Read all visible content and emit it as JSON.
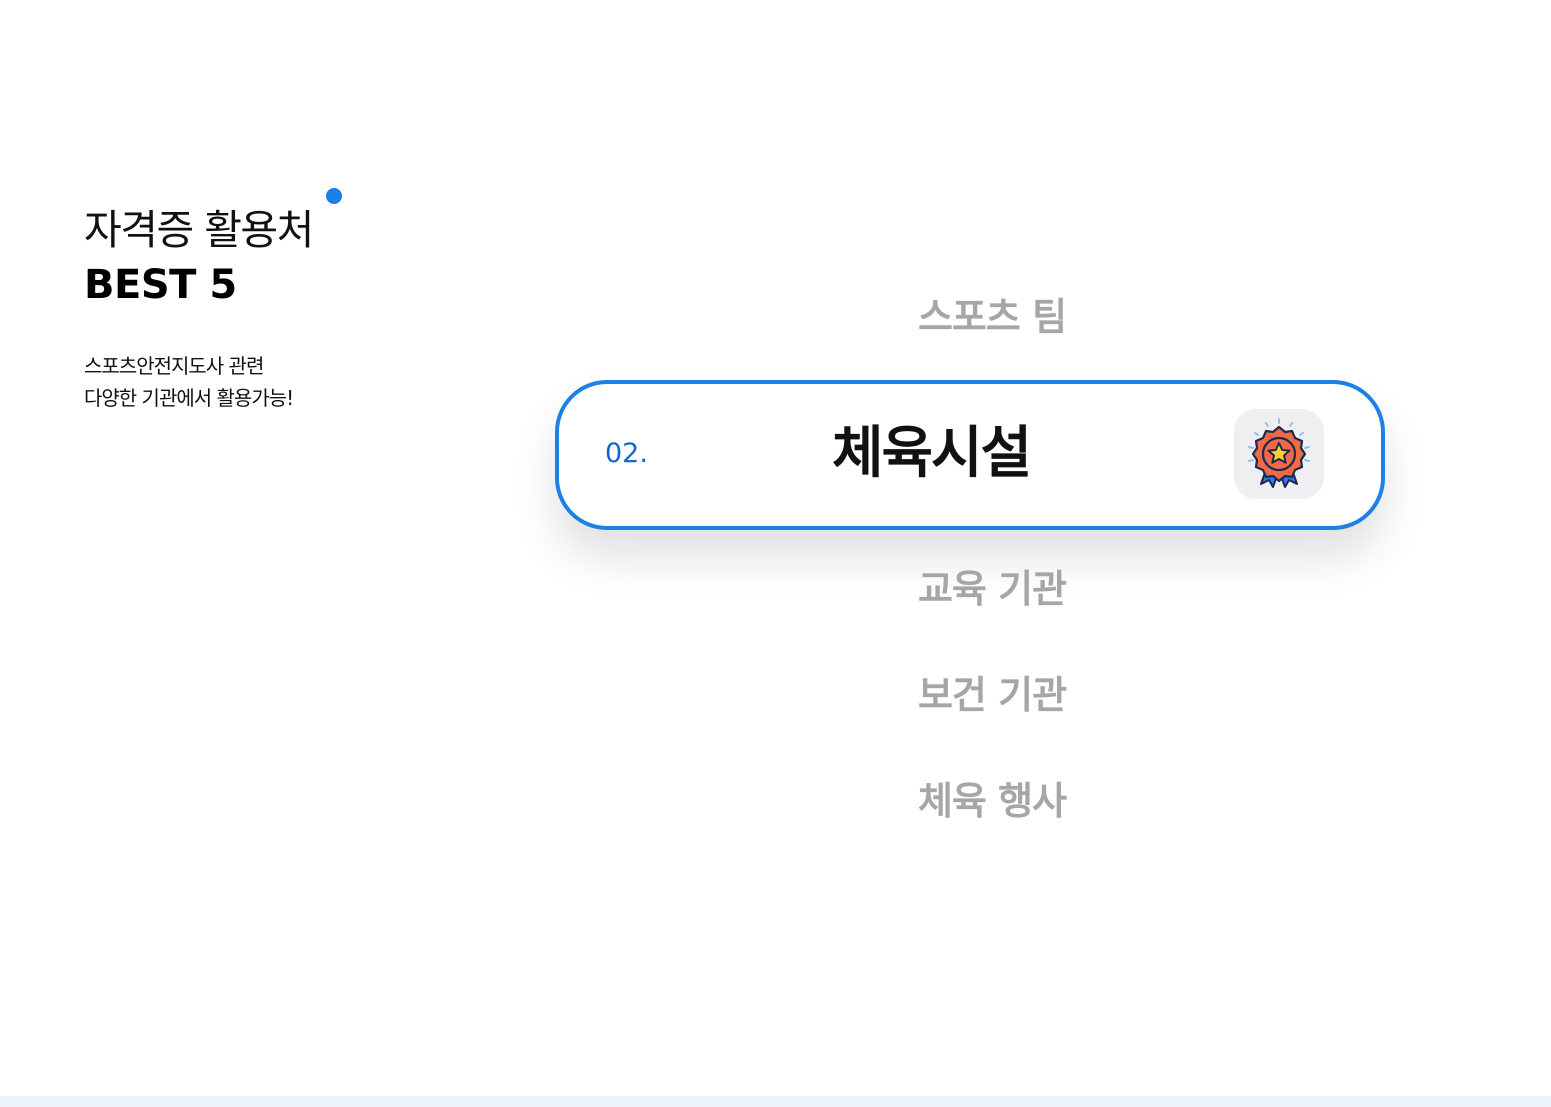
{
  "section": {
    "heading_line1": "자격증 활용처",
    "heading_line2": "BEST 5",
    "subtext_line1": "스포츠안전지도사 관련",
    "subtext_line2": "다양한 기관에서 활용가능!"
  },
  "colors": {
    "accent": "#1c80e6",
    "number": "#1466d6",
    "inactive_text": "#a6a6a6",
    "active_text": "#111111"
  },
  "list": {
    "items": [
      {
        "label": "스포츠 팀"
      },
      {
        "label": "체육시설"
      },
      {
        "label": "교육 기관"
      },
      {
        "label": "보건 기관"
      },
      {
        "label": "체육 행사"
      }
    ],
    "active": {
      "number": "02.",
      "label": "체육시설",
      "icon": "award-badge-icon"
    }
  }
}
